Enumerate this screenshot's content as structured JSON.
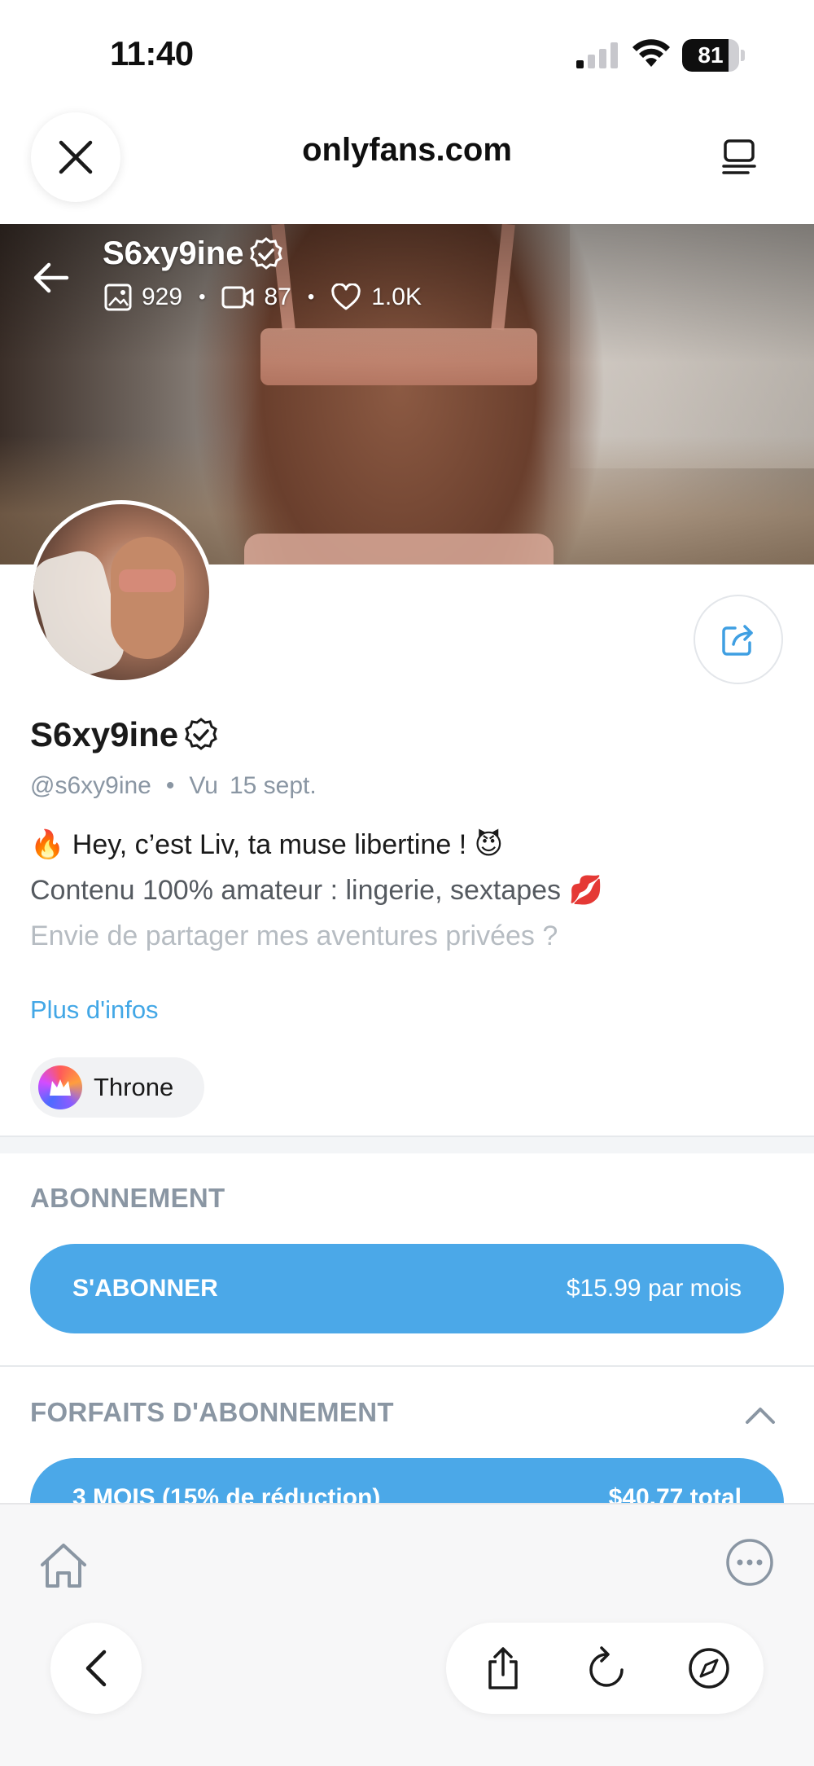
{
  "status_bar": {
    "time": "11:40",
    "battery": "81",
    "battery_level": 0.81
  },
  "browser": {
    "url": "onlyfans.com"
  },
  "cover": {
    "name": "S6xy9ine",
    "stats": {
      "photos": "929",
      "videos": "87",
      "likes": "1.0K"
    }
  },
  "profile": {
    "name": "S6xy9ine",
    "handle": "@s6xy9ine",
    "separator": "•",
    "seen_prefix": "Vu",
    "seen_date": "15 sept.",
    "bio": [
      "🔥 Hey, c’est Liv, ta muse libertine ! 😈",
      "Contenu 100% amateur : lingerie, sextapes 💋",
      "Envie de partager mes aventures privées ?"
    ],
    "more_link": "Plus d'infos",
    "chip_label": "Throne"
  },
  "subscription": {
    "title": "ABONNEMENT",
    "button_label": "S'ABONNER",
    "button_price": "$15.99 par mois"
  },
  "plans": {
    "title": "FORFAITS D'ABONNEMENT",
    "first_plan_label": "3 MOIS (15% de réduction)",
    "first_plan_price": "$40.77 total"
  },
  "colors": {
    "accent": "#4ba8e8",
    "link": "#42a7e6",
    "muted": "#8a96a3"
  },
  "icons": {
    "close": "close-icon",
    "tabs": "tabs-icon",
    "back": "arrow-left-icon",
    "verified": "verified-badge-icon",
    "photo": "image-icon",
    "video": "video-icon",
    "heart": "heart-icon",
    "share": "share-icon",
    "chevron": "chevron-up-icon",
    "home": "home-icon",
    "more": "more-icon",
    "safari_back": "chevron-left-icon",
    "safari_share": "share-box-icon",
    "reload": "reload-icon",
    "compass": "compass-icon"
  }
}
